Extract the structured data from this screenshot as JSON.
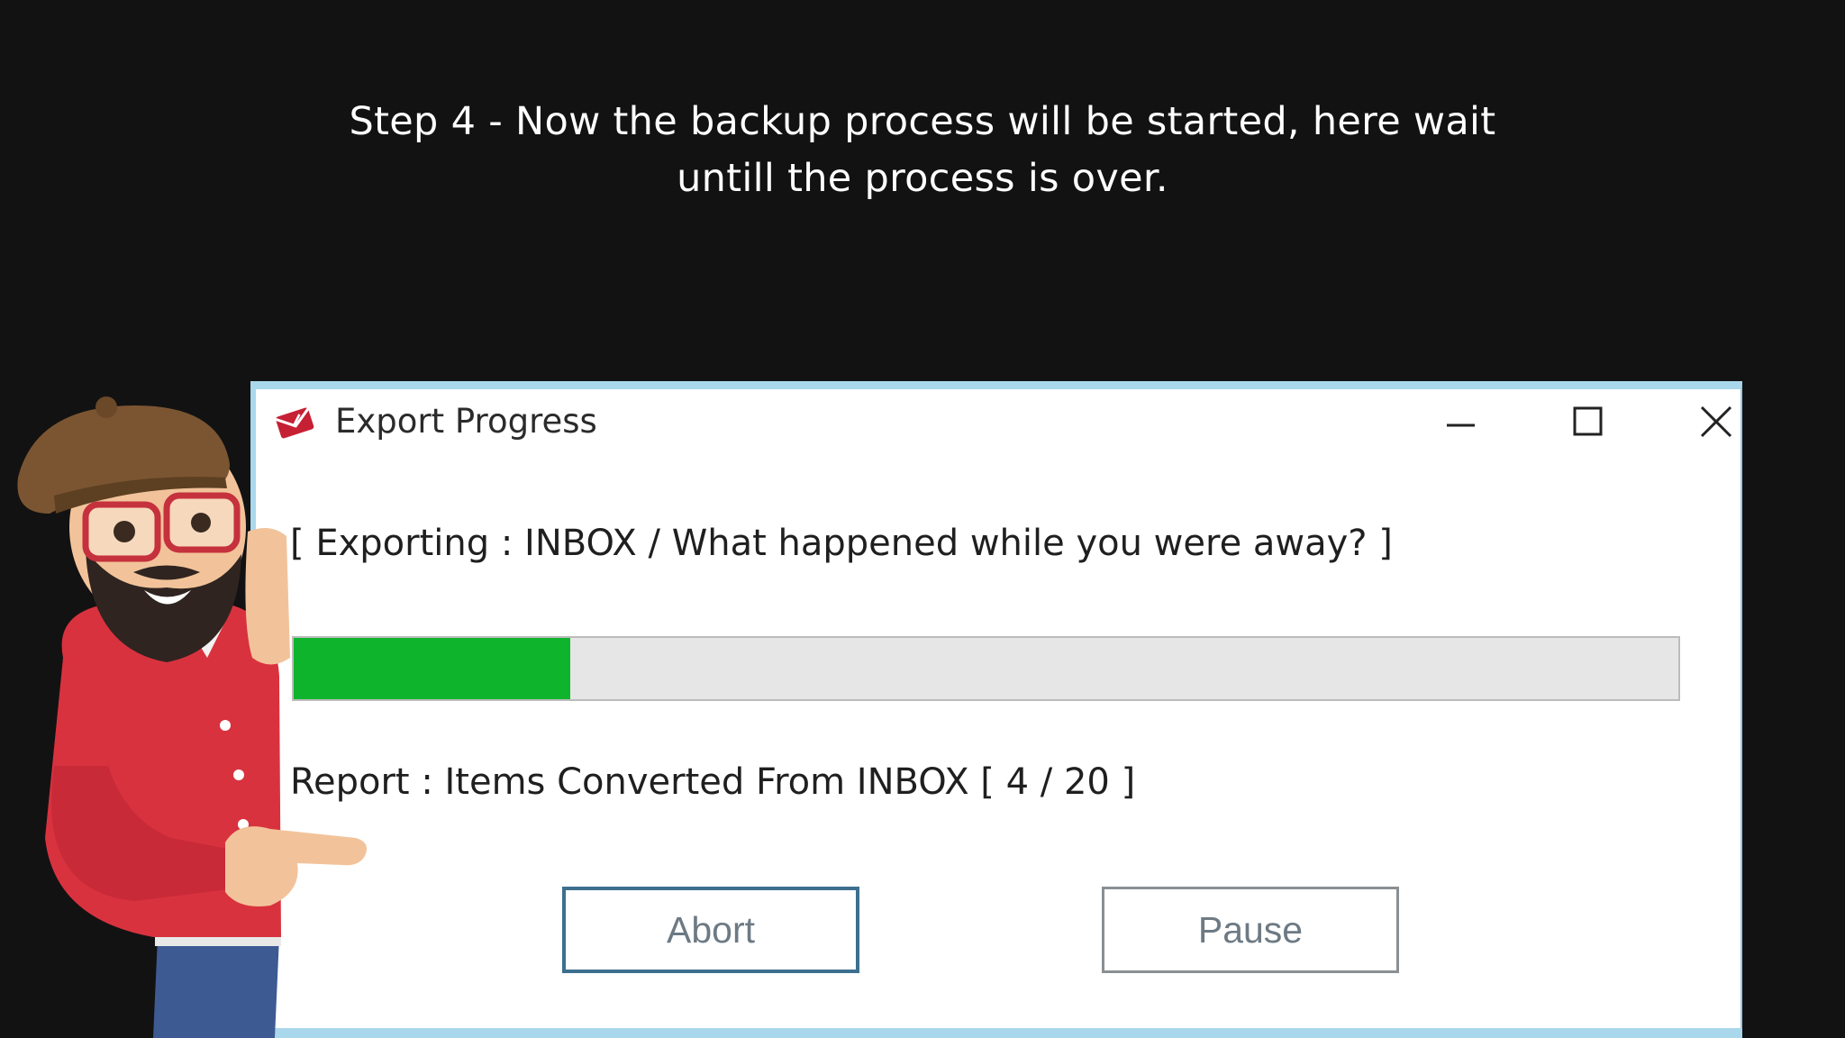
{
  "caption": {
    "line1": "Step 4 - Now the backup process will be started, here wait",
    "line2": "untill the process is over."
  },
  "window": {
    "title": "Export Progress",
    "app_icon": "envelope-logo-icon",
    "controls": {
      "minimize_icon": "minimize-icon",
      "maximize_icon": "maximize-icon",
      "close_icon": "close-icon"
    }
  },
  "export": {
    "status_text": "[ Exporting : INBOX / What happened while you were away? ]"
  },
  "progress": {
    "fraction": 0.2,
    "fill_color": "#0fb42d",
    "track_color": "#e6e6e6"
  },
  "report": {
    "text": "Report :  Items Converted From INBOX [ 4 / 20 ]"
  },
  "buttons": {
    "abort_label": "Abort",
    "pause_label": "Pause"
  },
  "colors": {
    "background": "#121212",
    "window_border": "#a9d7ec"
  }
}
